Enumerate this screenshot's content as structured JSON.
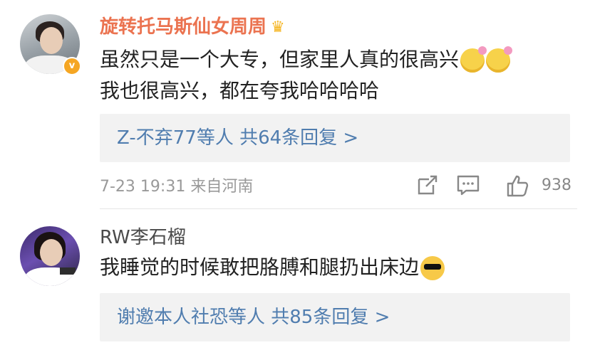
{
  "comments": [
    {
      "username": "旋转托马斯仙女周周",
      "text_line1": "虽然只是一个大专，但家里人真的很高兴",
      "text_line2": "我也很高兴，都在夸我哈哈哈哈",
      "replies": "Z-不弃77等人 共64条回复 >",
      "meta": "7-23 19:31 来自河南",
      "likes": "938",
      "emojis": [
        "smiling-flower-emoji",
        "smiling-flower-emoji"
      ],
      "badge_icon": "crown-icon"
    },
    {
      "username": "RW李石榴",
      "text": "我睡觉的时候敢把胳膊和腿扔出床边",
      "replies": "谢邀本人社恐等人 共85条回复 >",
      "emoji": "sunglasses-emoji"
    }
  ],
  "colors": {
    "vip_name": "#eb7350",
    "link": "#507daf",
    "reply_bg": "#f2f2f2",
    "meta": "#999999"
  }
}
